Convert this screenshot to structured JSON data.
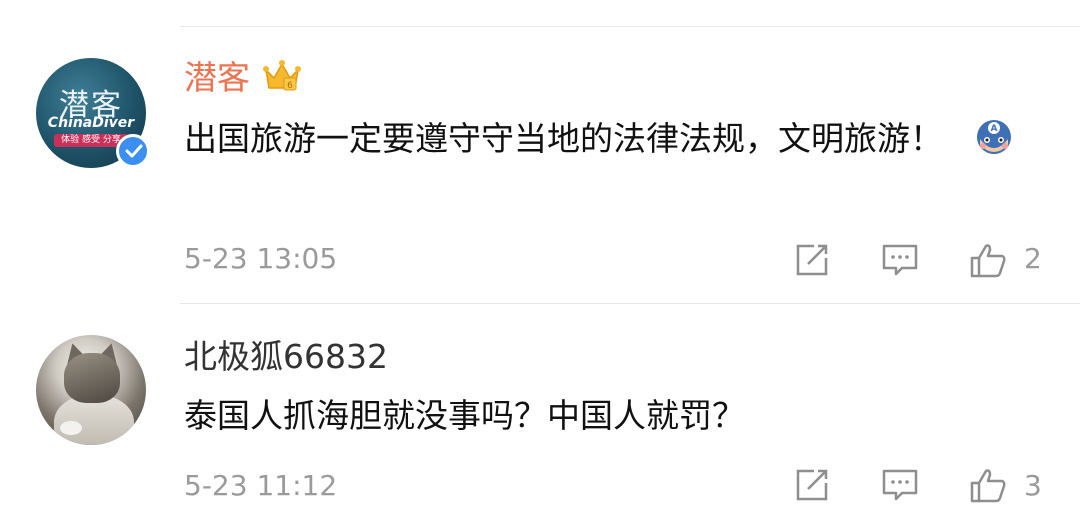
{
  "comments": [
    {
      "avatar": {
        "logo_cn": "潜客",
        "logo_en": "ChinaDiver",
        "logo_tag": "体验 感受 分享",
        "verified": true
      },
      "username": "潜客",
      "badge": "crown-vip-icon",
      "content": "出国旅游一定要遵守守当地的法律法规，文明旅游！",
      "emoji": "captain-america-emoji",
      "time": "5-23 13:05",
      "likes": "2"
    },
    {
      "avatar": {
        "description": "cat"
      },
      "username": "北极狐66832",
      "content": "泰国人抓海胆就没事吗？中国人就罚？",
      "time": "5-23 11:12",
      "likes": "3"
    }
  ],
  "colors": {
    "vip_name": "#eb7350",
    "normal_name": "#333333",
    "meta": "#9a9a9a",
    "verified": "#3b8ff0"
  }
}
